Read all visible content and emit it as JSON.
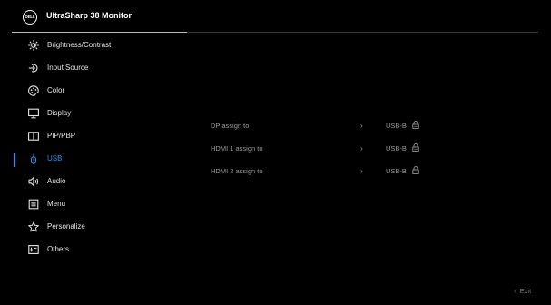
{
  "header": {
    "logo_text": "DELL",
    "title": "UltraSharp 38 Monitor"
  },
  "menu": [
    {
      "label": "Brightness/Contrast",
      "icon": "sun-icon"
    },
    {
      "label": "Input Source",
      "icon": "input-source-icon"
    },
    {
      "label": "Color",
      "icon": "color-palette-icon"
    },
    {
      "label": "Display",
      "icon": "display-monitor-icon"
    },
    {
      "label": "PIP/PBP",
      "icon": "pip-pbp-icon"
    },
    {
      "label": "USB",
      "icon": "usb-icon",
      "active": true
    },
    {
      "label": "Audio",
      "icon": "speaker-icon"
    },
    {
      "label": "Menu",
      "icon": "menu-icon"
    },
    {
      "label": "Personalize",
      "icon": "star-icon"
    },
    {
      "label": "Others",
      "icon": "others-icon"
    }
  ],
  "usb_settings": [
    {
      "label": "DP assign to",
      "value": "USB-B"
    },
    {
      "label": "HDMI 1 assign to",
      "value": "USB-B"
    },
    {
      "label": "HDMI 2 assign to",
      "value": "USB-B"
    }
  ],
  "footer": {
    "exit_label": "Exit"
  },
  "colors": {
    "accent": "#2f8ef0",
    "background": "#000000"
  }
}
